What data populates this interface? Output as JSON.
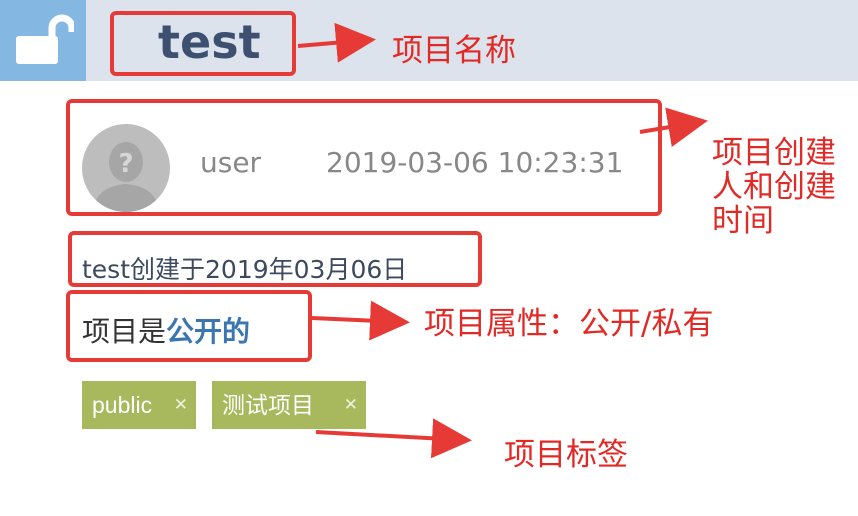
{
  "project": {
    "name": "test",
    "owner": "user",
    "created_at": "2019-03-06 10:23:31",
    "created_text": "test创建于2019年03月06日",
    "visibility_prefix": "项目是",
    "visibility_value": "公开的",
    "tags": [
      "public",
      "测试项目"
    ]
  },
  "annotations": {
    "name": "项目名称",
    "creator_line1": "项目创建",
    "creator_line2": "人和创建",
    "creator_line3": "时间",
    "visibility": "项目属性：公开/私有",
    "tags": "项目标签"
  },
  "icons": {
    "lock": "unlock-icon",
    "avatar": "default-avatar-icon",
    "tag_remove": "remove-tag-icon"
  },
  "colors": {
    "header_bg": "#dde3ec",
    "lock_bg": "#84b7e2",
    "annotation_red": "#e12a26",
    "tag_bg": "#a8b85c",
    "visibility_blue": "#3a77b0"
  }
}
